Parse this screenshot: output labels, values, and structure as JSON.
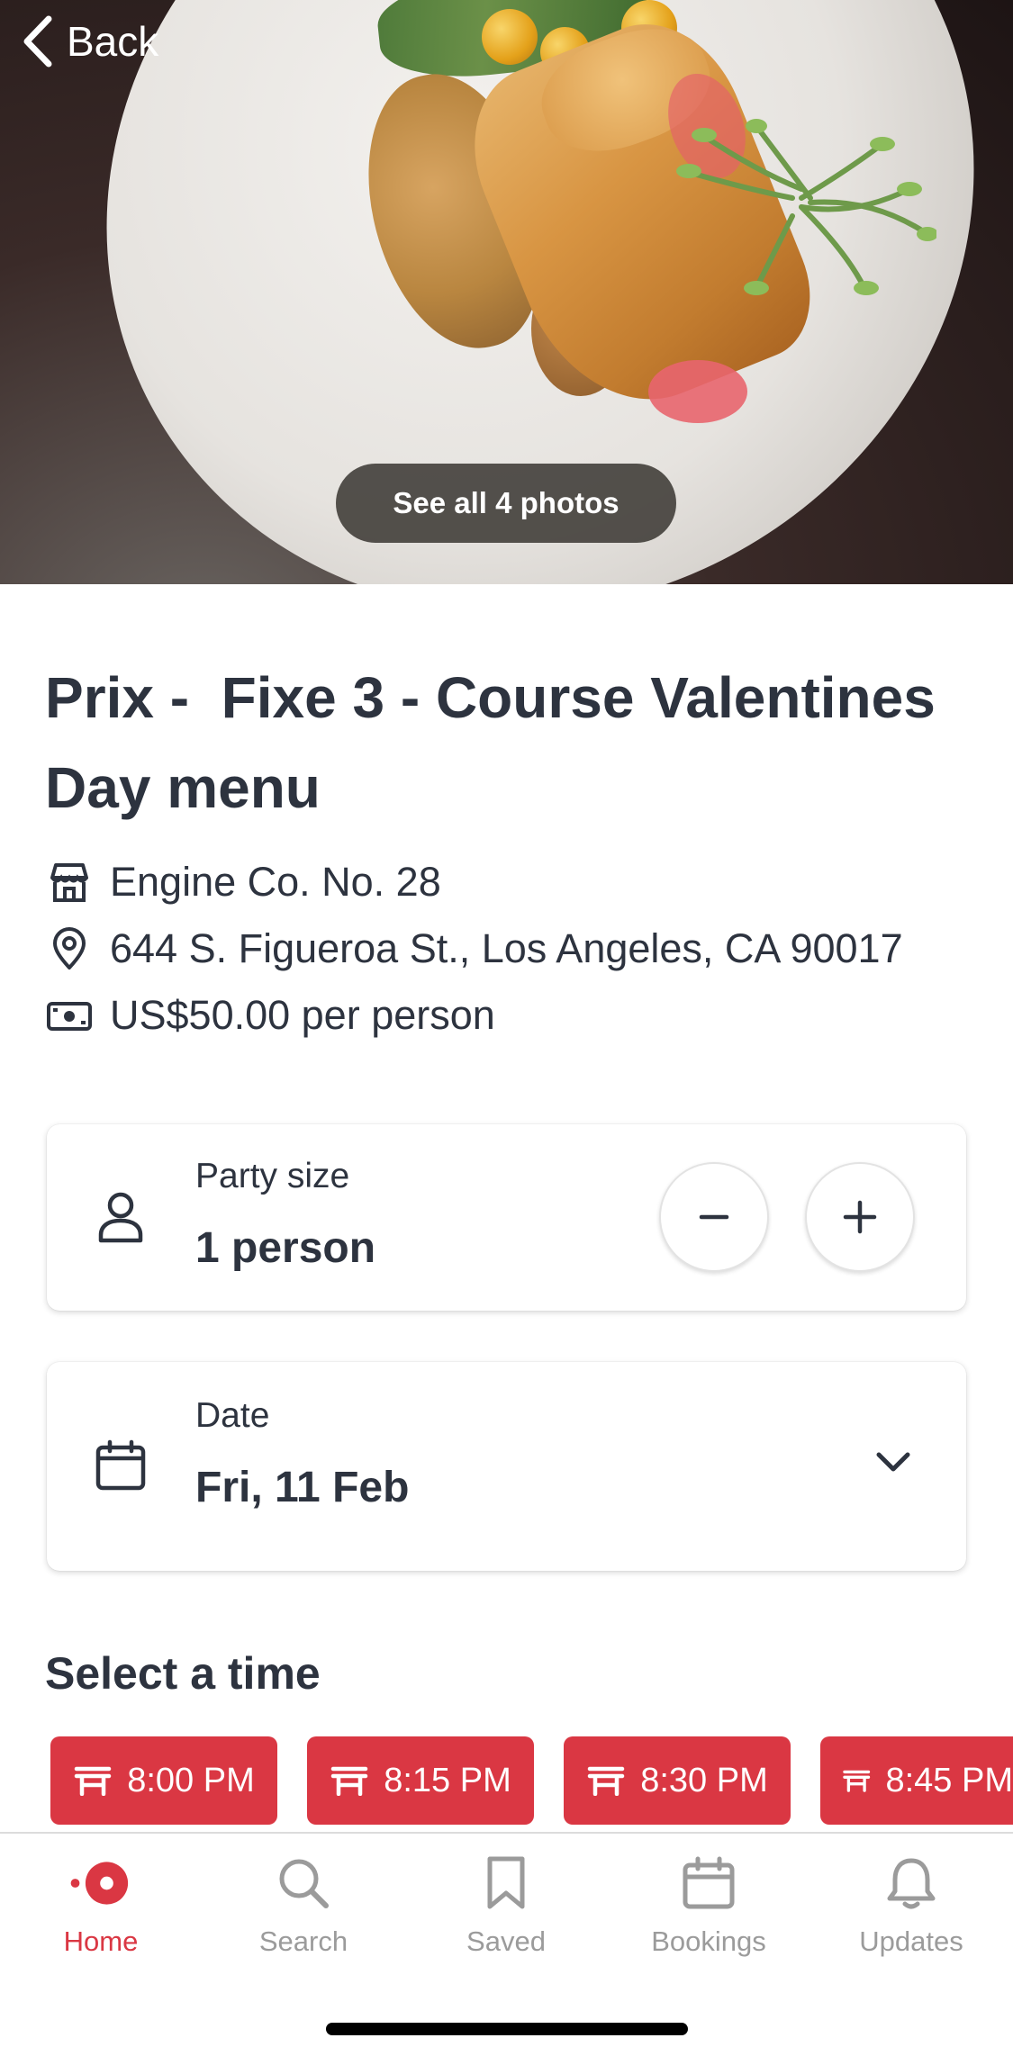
{
  "header": {
    "back_label": "Back",
    "see_photos_label": "See all 4 photos"
  },
  "offer": {
    "title": "Prix -  Fixe 3 - Course Valentines Day menu",
    "restaurant": "Engine Co. No. 28",
    "address": "644 S. Figueroa St., Los Angeles, CA 90017",
    "price": "US$50.00 per person"
  },
  "party": {
    "label": "Party size",
    "value": "1 person"
  },
  "date": {
    "label": "Date",
    "value": "Fri, 11 Feb"
  },
  "times": {
    "title": "Select a time",
    "slots": [
      "8:00 PM",
      "8:15 PM",
      "8:30 PM",
      "8:45 PM"
    ]
  },
  "tabbar": {
    "items": [
      {
        "label": "Home",
        "icon": "home-icon",
        "active": true
      },
      {
        "label": "Search",
        "icon": "search-icon",
        "active": false
      },
      {
        "label": "Saved",
        "icon": "bookmark-icon",
        "active": false
      },
      {
        "label": "Bookings",
        "icon": "calendar-icon",
        "active": false
      },
      {
        "label": "Updates",
        "icon": "bell-icon",
        "active": false
      }
    ]
  },
  "colors": {
    "accent": "#da3743",
    "text": "#2d333f",
    "inactive": "#9b9b9b"
  }
}
